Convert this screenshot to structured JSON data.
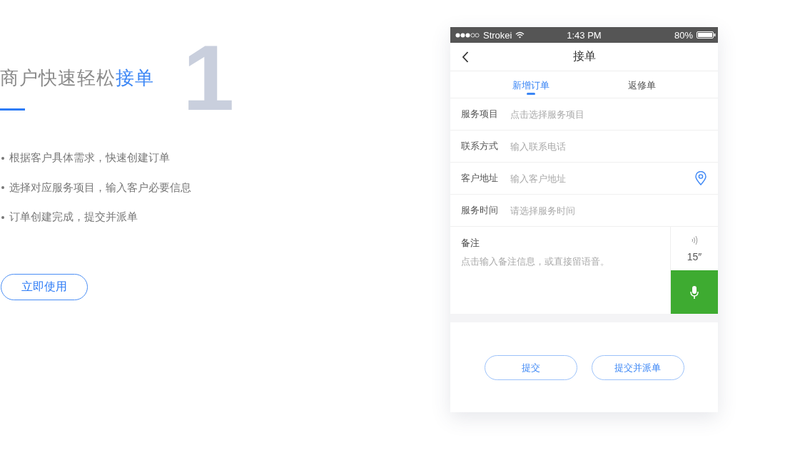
{
  "intro": {
    "number": "1",
    "title": "商户快速轻松",
    "title_highlight": "接单",
    "bullets": [
      "根据客户具体需求，快速创建订单",
      "选择对应服务项目，输入客户必要信息",
      "订单创建完成，提交并派单"
    ],
    "button": "立即使用"
  },
  "phone": {
    "status_bar": {
      "carrier": "Strokei",
      "time": "1:43 PM",
      "battery": "80%"
    },
    "nav_title": "接单",
    "tabs": [
      {
        "label": "新增订单",
        "selected": true
      },
      {
        "label": "返修单",
        "selected": false
      }
    ],
    "fields": [
      {
        "label": "服务项目",
        "placeholder": "点击选择服务项目",
        "kind": "plain"
      },
      {
        "label": "联系方式",
        "placeholder": "输入联系电话",
        "kind": "plain"
      },
      {
        "label": "客户地址",
        "placeholder": "输入客户地址",
        "kind": "location"
      },
      {
        "label": "服务时间",
        "placeholder": "请选择服务时间",
        "kind": "plain"
      }
    ],
    "remark": {
      "label": "备注",
      "placeholder": "点击输入备注信息，或直接留语音。",
      "duration": "15″"
    },
    "buttons": [
      "提交",
      "提交并派单"
    ]
  }
}
